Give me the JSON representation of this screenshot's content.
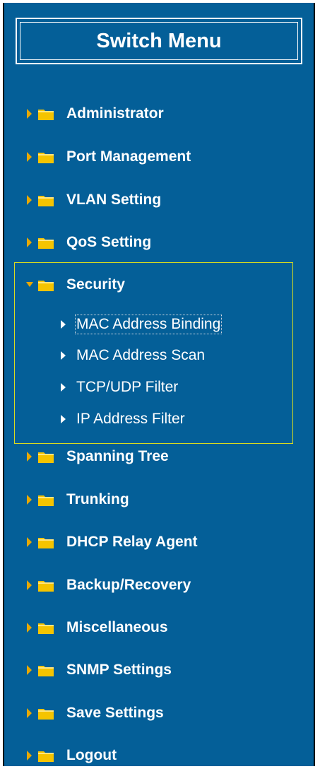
{
  "menu": {
    "title": "Switch Menu",
    "items": [
      {
        "label": "Administrator",
        "icon": "folder-icon"
      },
      {
        "label": "Port Management",
        "icon": "folder-icon"
      },
      {
        "label": "VLAN Setting",
        "icon": "folder-icon"
      },
      {
        "label": "QoS Setting",
        "icon": "folder-icon"
      },
      {
        "label": "Security",
        "icon": "folder-icon",
        "expanded": true
      },
      {
        "label": "Spanning Tree",
        "icon": "folder-icon"
      },
      {
        "label": "Trunking",
        "icon": "folder-icon"
      },
      {
        "label": "DHCP Relay Agent",
        "icon": "folder-icon"
      },
      {
        "label": "Backup/Recovery",
        "icon": "folder-icon"
      },
      {
        "label": "Miscellaneous",
        "icon": "folder-icon"
      },
      {
        "label": "SNMP Settings",
        "icon": "folder-icon"
      },
      {
        "label": "Save Settings",
        "icon": "folder-icon"
      },
      {
        "label": "Logout",
        "icon": "folder-icon"
      }
    ],
    "security_subitems": [
      {
        "label": "MAC Address Binding",
        "focused": true
      },
      {
        "label": "MAC Address Scan"
      },
      {
        "label": "TCP/UDP Filter"
      },
      {
        "label": "IP Address Filter"
      }
    ]
  },
  "colors": {
    "background": "#045f98",
    "text": "#ffffff",
    "folder": "#f5c400",
    "arrow": "#e8a800",
    "selection_border": "#d7dc1e"
  }
}
